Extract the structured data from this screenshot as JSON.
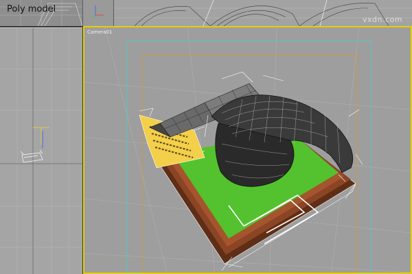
{
  "app": {
    "title": "Poly model"
  },
  "watermark": "vxdn.com",
  "viewports": {
    "main": {
      "label": "Camera01"
    }
  },
  "colors": {
    "active_viewport_border": "#e5d000",
    "grass": "#53c22e",
    "frame": "#7a3a1c",
    "paper": "#f4cf4a",
    "safe_frame_outer": "#57c7c7",
    "safe_frame_inner": "#d79a2a"
  }
}
